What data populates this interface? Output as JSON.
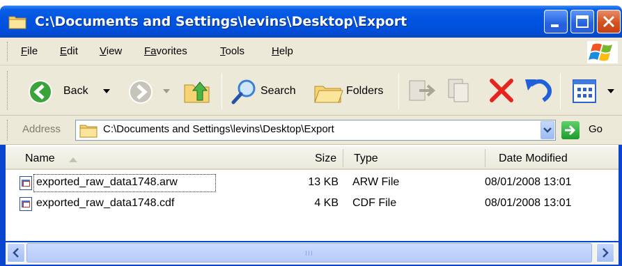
{
  "window": {
    "title": "C:\\Documents and Settings\\levins\\Desktop\\Export"
  },
  "menu": {
    "items": [
      {
        "first": "F",
        "rest": "ile"
      },
      {
        "first": "E",
        "rest": "dit"
      },
      {
        "first": "V",
        "rest": "iew"
      },
      {
        "first": "Fa",
        "rest": "vorites"
      },
      {
        "first": "T",
        "rest": "ools"
      },
      {
        "first": "H",
        "rest": "elp"
      }
    ]
  },
  "toolbar": {
    "back_label": "Back",
    "search_label": "Search",
    "folders_label": "Folders"
  },
  "address": {
    "label": "Address",
    "value": "C:\\Documents and Settings\\levins\\Desktop\\Export",
    "go_label": "Go"
  },
  "columns": {
    "name": "Name",
    "size": "Size",
    "type": "Type",
    "date": "Date Modified"
  },
  "files": [
    {
      "name": "exported_raw_data1748.arw",
      "size": "13 KB",
      "type": "ARW File",
      "date": "08/01/2008 13:01"
    },
    {
      "name": "exported_raw_data1748.cdf",
      "size": "4 KB",
      "type": "CDF File",
      "date": "08/01/2008 13:01"
    }
  ],
  "colors": {
    "titlebar": "#0053e1",
    "chrome": "#ece9d8",
    "close": "#d5511f"
  },
  "scrollbar": {
    "grip": "III"
  }
}
